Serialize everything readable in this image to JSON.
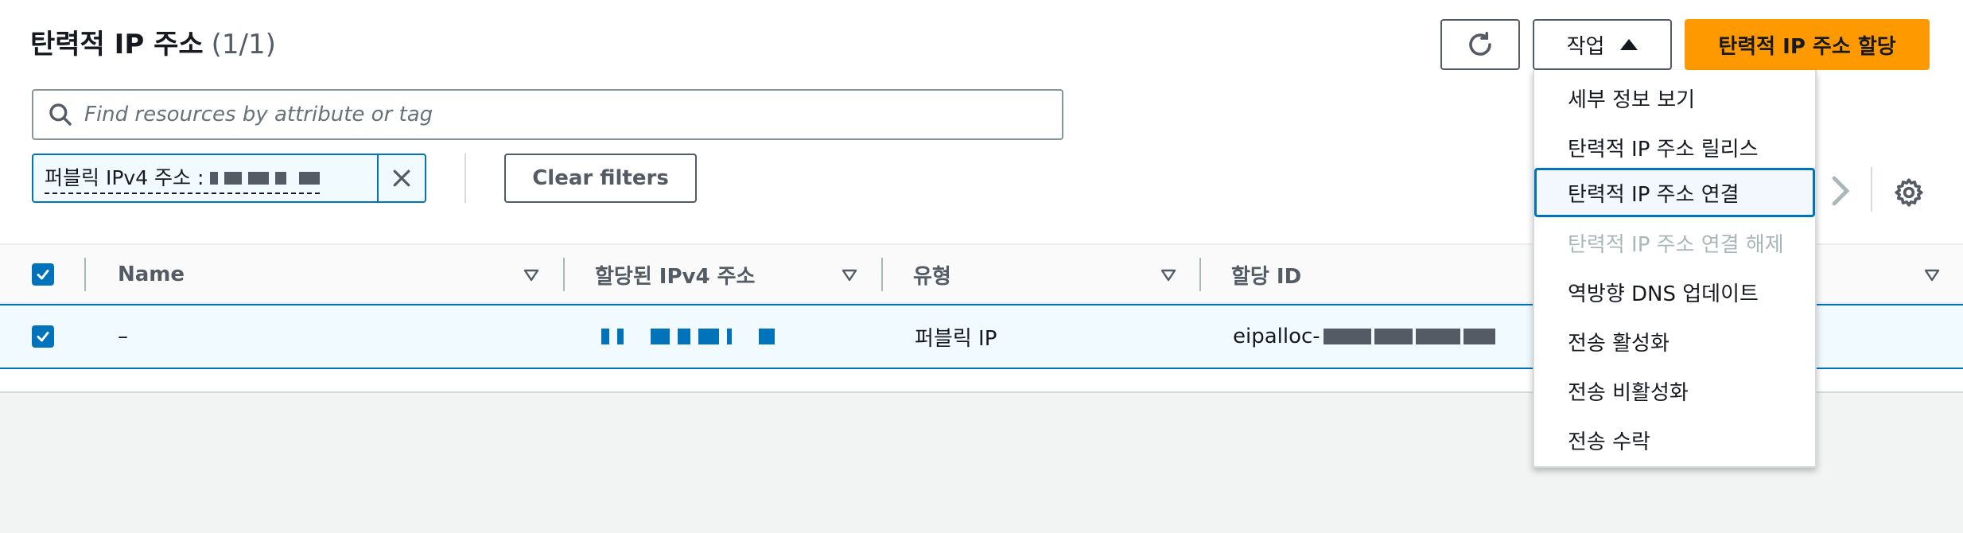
{
  "header": {
    "title": "탄력적 IP 주소",
    "count": "(1/1)",
    "actions_label": "작업",
    "allocate_label": "탄력적 IP 주소 할당"
  },
  "search": {
    "placeholder": "Find resources by attribute or tag",
    "value": ""
  },
  "filter_token": {
    "label": "퍼블릭 IPv4 주소 :",
    "value_redacted": true
  },
  "clear_filters_label": "Clear filters",
  "table": {
    "columns": [
      "Name",
      "할당된 IPv4 주소",
      "유형",
      "할당 ID"
    ],
    "rows": [
      {
        "selected": true,
        "name": "–",
        "ipv4": "",
        "type": "퍼블릭 IP",
        "allocation_id_prefix": "eipalloc-"
      }
    ]
  },
  "actions_menu": {
    "items": [
      {
        "label": "세부 정보 보기",
        "disabled": false,
        "focused": false
      },
      {
        "label": "탄력적 IP 주소 릴리스",
        "disabled": false,
        "focused": false
      },
      {
        "label": "탄력적 IP 주소 연결",
        "disabled": false,
        "focused": true
      },
      {
        "label": "탄력적 IP 주소 연결 해제",
        "disabled": true,
        "focused": false
      },
      {
        "label": "역방향 DNS 업데이트",
        "disabled": false,
        "focused": false
      },
      {
        "label": "전송 활성화",
        "disabled": false,
        "focused": false
      },
      {
        "label": "전송 비활성화",
        "disabled": false,
        "focused": false
      },
      {
        "label": "전송 수락",
        "disabled": false,
        "focused": false
      }
    ]
  },
  "icons": {
    "refresh": "refresh-icon",
    "caret": "caret-up-icon",
    "search": "search-icon",
    "close": "close-icon",
    "next": "chevron-right-icon",
    "settings": "gear-icon",
    "sort": "sort-caret-icon",
    "check": "checkmark-icon"
  },
  "colors": {
    "primary": "#ff9900",
    "link": "#0073bb",
    "selected_row": "#f1faff",
    "border": "#545b64"
  }
}
